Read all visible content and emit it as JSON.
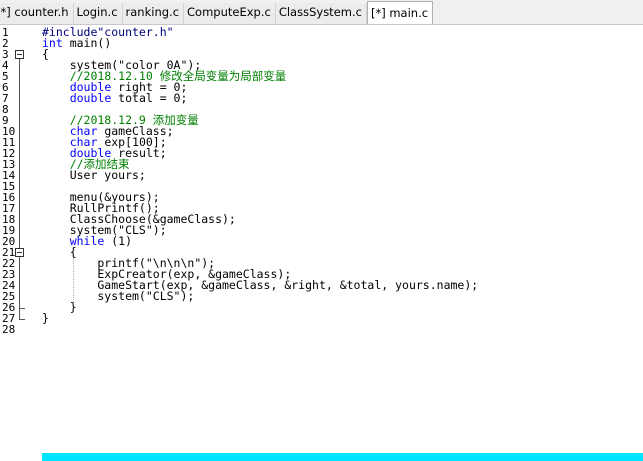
{
  "tabs": [
    {
      "label": "[*] counter.h",
      "active": false
    },
    {
      "label": "Login.c",
      "active": false
    },
    {
      "label": "ranking.c",
      "active": false
    },
    {
      "label": "ComputeExp.c",
      "active": false
    },
    {
      "label": "ClassSystem.c",
      "active": false
    },
    {
      "label": "[*] main.c",
      "active": true
    }
  ],
  "colors": {
    "keyword": "#0000ff",
    "comment": "#008000",
    "preprocessor": "#000080",
    "current_line": "#00e5ff"
  },
  "editor": {
    "lines": [
      {
        "num": "1",
        "tokens": [
          {
            "t": "#include\"counter.h\"",
            "c": "pp"
          }
        ]
      },
      {
        "num": "2",
        "tokens": [
          {
            "t": "int",
            "c": "kw"
          },
          {
            "t": " main()",
            "c": ""
          }
        ]
      },
      {
        "num": "3",
        "tokens": [
          {
            "t": "{",
            "c": ""
          }
        ]
      },
      {
        "num": "4",
        "tokens": [
          {
            "t": "    system(\"color 0A\");",
            "c": ""
          }
        ]
      },
      {
        "num": "5",
        "tokens": [
          {
            "t": "    //2018.12.10 修改全局变量为局部变量",
            "c": "cm"
          }
        ]
      },
      {
        "num": "6",
        "tokens": [
          {
            "t": "    ",
            "c": ""
          },
          {
            "t": "double",
            "c": "kw"
          },
          {
            "t": " right = 0;",
            "c": ""
          }
        ]
      },
      {
        "num": "7",
        "tokens": [
          {
            "t": "    ",
            "c": ""
          },
          {
            "t": "double",
            "c": "kw"
          },
          {
            "t": " total = 0;",
            "c": ""
          }
        ]
      },
      {
        "num": "8",
        "tokens": []
      },
      {
        "num": "9",
        "tokens": [
          {
            "t": "    //2018.12.9 添加变量",
            "c": "cm"
          }
        ]
      },
      {
        "num": "10",
        "tokens": [
          {
            "t": "    ",
            "c": ""
          },
          {
            "t": "char",
            "c": "kw"
          },
          {
            "t": " gameClass;",
            "c": ""
          }
        ]
      },
      {
        "num": "11",
        "tokens": [
          {
            "t": "    ",
            "c": ""
          },
          {
            "t": "char",
            "c": "kw"
          },
          {
            "t": " exp[100];",
            "c": ""
          }
        ]
      },
      {
        "num": "12",
        "tokens": [
          {
            "t": "    ",
            "c": ""
          },
          {
            "t": "double",
            "c": "kw"
          },
          {
            "t": " result;",
            "c": ""
          }
        ]
      },
      {
        "num": "13",
        "tokens": [
          {
            "t": "    //添加结束",
            "c": "cm"
          }
        ]
      },
      {
        "num": "14",
        "tokens": [
          {
            "t": "    User yours;",
            "c": ""
          }
        ]
      },
      {
        "num": "15",
        "tokens": []
      },
      {
        "num": "16",
        "tokens": [
          {
            "t": "    menu(&yours);",
            "c": ""
          }
        ]
      },
      {
        "num": "17",
        "tokens": [
          {
            "t": "    RullPrintf();",
            "c": ""
          }
        ]
      },
      {
        "num": "18",
        "tokens": [
          {
            "t": "    ClassChoose(&gameClass);",
            "c": ""
          }
        ]
      },
      {
        "num": "19",
        "tokens": [
          {
            "t": "    system(\"CLS\");",
            "c": ""
          }
        ]
      },
      {
        "num": "20",
        "tokens": [
          {
            "t": "    ",
            "c": ""
          },
          {
            "t": "while",
            "c": "kw"
          },
          {
            "t": " (1)",
            "c": ""
          }
        ]
      },
      {
        "num": "21",
        "tokens": [
          {
            "t": "    {",
            "c": ""
          }
        ]
      },
      {
        "num": "22",
        "tokens": [
          {
            "t": "        printf(\"\\n\\n\\n\");",
            "c": ""
          }
        ]
      },
      {
        "num": "23",
        "tokens": [
          {
            "t": "        ExpCreator(exp, &gameClass);",
            "c": ""
          }
        ]
      },
      {
        "num": "24",
        "tokens": [
          {
            "t": "        GameStart(exp, &gameClass, &right, &total, yours.name);",
            "c": ""
          }
        ]
      },
      {
        "num": "25",
        "tokens": [
          {
            "t": "        system(\"CLS\");",
            "c": ""
          }
        ]
      },
      {
        "num": "26",
        "tokens": [
          {
            "t": "    }",
            "c": ""
          }
        ]
      },
      {
        "num": "27",
        "tokens": [
          {
            "t": "}",
            "c": ""
          }
        ]
      },
      {
        "num": "28",
        "tokens": []
      }
    ]
  }
}
